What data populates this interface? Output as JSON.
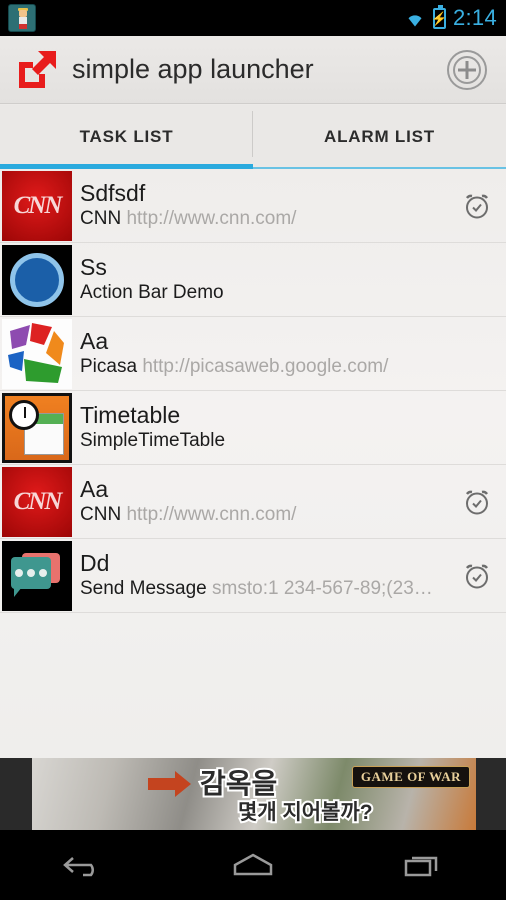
{
  "status_bar": {
    "notification_icon": "game-character-icon",
    "wifi_icon": "wifi-icon",
    "battery_icon": "battery-charging-icon",
    "time": "2:14",
    "accent_color": "#3ab0e2"
  },
  "action_bar": {
    "logo_icon": "launch-external-link-icon",
    "title": "simple app launcher",
    "add_button_icon": "circled-plus-icon",
    "logo_color": "#e81c1c"
  },
  "tabs": {
    "active_index": 0,
    "indicator_color": "#2aaade",
    "items": [
      {
        "label": "TASK LIST",
        "active": true
      },
      {
        "label": "ALARM LIST",
        "active": false
      }
    ]
  },
  "task_list": {
    "rows": [
      {
        "icon": "cnn-logo-icon",
        "icon_text": "CNN",
        "title": "Sdfsdf",
        "subtitle": "CNN",
        "url": "http://www.cnn.com/",
        "has_alarm": true,
        "alarm_icon": "alarm-clock-icon"
      },
      {
        "icon": "action-bar-demo-icon",
        "icon_text": "",
        "title": "Ss",
        "subtitle": "Action Bar Demo",
        "url": "",
        "has_alarm": false,
        "alarm_icon": ""
      },
      {
        "icon": "picasa-logo-icon",
        "icon_text": "",
        "title": "Aa",
        "subtitle": "Picasa",
        "url": "http://picasaweb.google.com/",
        "has_alarm": false,
        "alarm_icon": ""
      },
      {
        "icon": "simple-timetable-icon",
        "icon_text": "",
        "title": "Timetable",
        "subtitle": "SimpleTimeTable",
        "url": "",
        "has_alarm": false,
        "alarm_icon": ""
      },
      {
        "icon": "cnn-logo-icon",
        "icon_text": "CNN",
        "title": "Aa",
        "subtitle": "CNN",
        "url": "http://www.cnn.com/",
        "has_alarm": true,
        "alarm_icon": "alarm-clock-icon"
      },
      {
        "icon": "messaging-icon",
        "icon_text": "",
        "title": "Dd",
        "subtitle": "Send Message",
        "url": "smsto:1 234-567-89;(23…",
        "has_alarm": true,
        "alarm_icon": "alarm-clock-icon"
      }
    ]
  },
  "ad_banner": {
    "headline": "감옥을",
    "subline": "몇개 지어볼까?",
    "brand": "GAME OF WAR",
    "arrow_icon": "right-arrow-icon"
  },
  "nav_bar": {
    "back_icon": "back-arrow-icon",
    "home_icon": "home-icon",
    "recents_icon": "recent-apps-icon"
  }
}
